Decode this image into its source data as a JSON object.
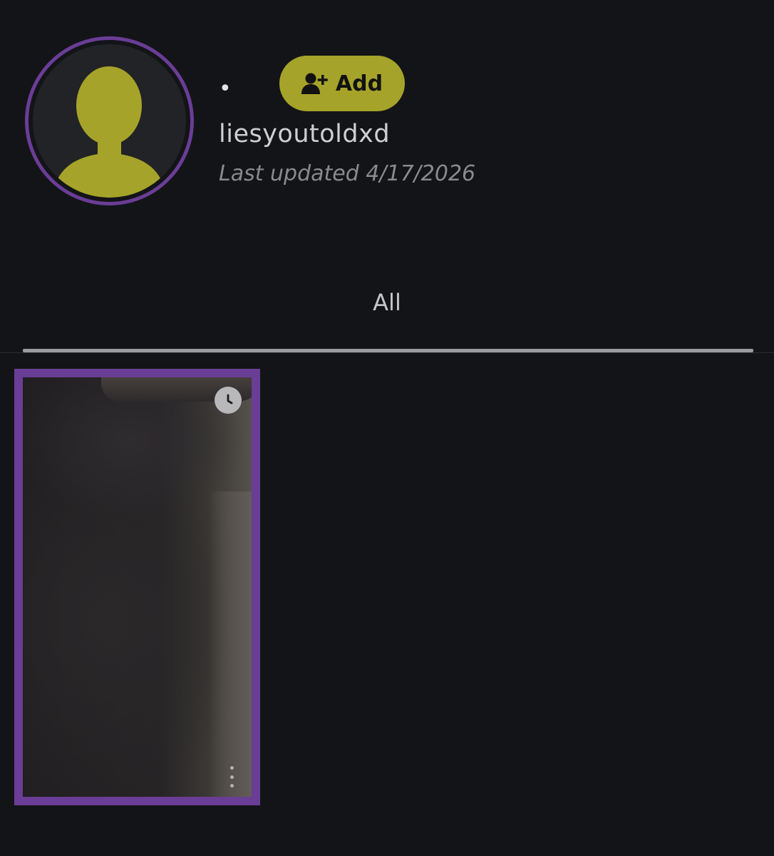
{
  "profile": {
    "display_name_dot": "•",
    "username": "liesyoutoldxd",
    "last_updated": "Last updated 4/17/2026",
    "avatar_icon": "person-silhouette-icon",
    "accent_color": "#6a3d96",
    "avatar_color": "#a6a32a"
  },
  "add_button": {
    "label": "Add",
    "icon": "add-user-icon",
    "color": "#a6a32a"
  },
  "tabs": [
    {
      "label": "All",
      "selected": true
    }
  ],
  "stories": [
    {
      "thumbnail": "blurred-photo",
      "badge_icon": "clock-icon",
      "menu_icon": "more-vertical-icon"
    }
  ]
}
